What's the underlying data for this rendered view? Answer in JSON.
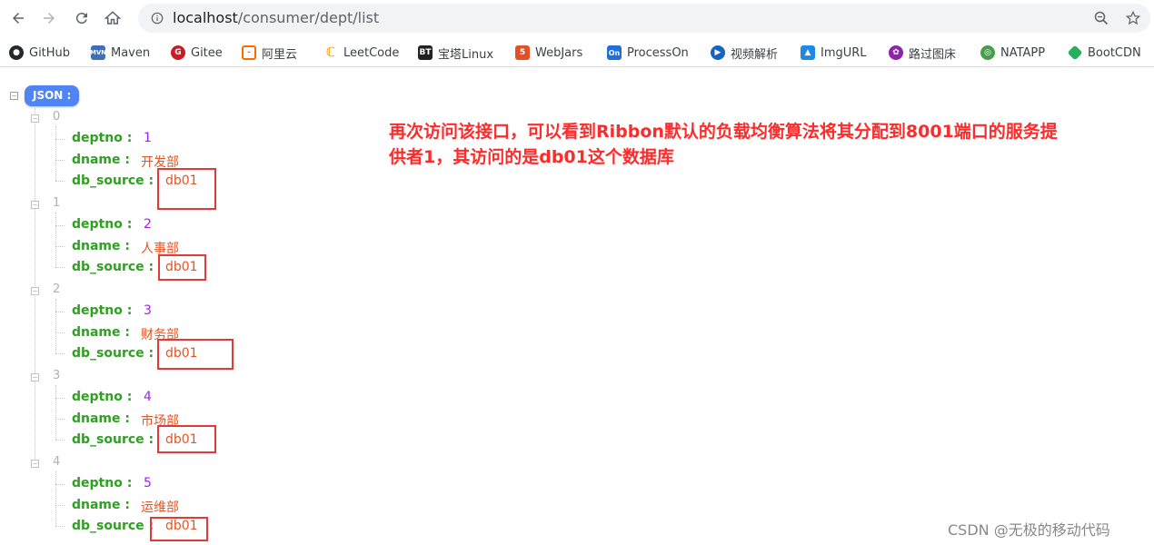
{
  "browser": {
    "url_host": "localhost",
    "url_path": "/consumer/dept/list"
  },
  "bookmarks": [
    {
      "label": "GitHub",
      "icon": "github-icon",
      "color": "#24292e"
    },
    {
      "label": "Maven",
      "icon": "maven-icon",
      "color": "#3f6fb5"
    },
    {
      "label": "Gitee",
      "icon": "gitee-icon",
      "color": "#c71d23"
    },
    {
      "label": "阿里云",
      "icon": "aliyun-icon",
      "color": "#ff6a00"
    },
    {
      "label": "LeetCode",
      "icon": "leetcode-icon",
      "color": "#ffa116"
    },
    {
      "label": "宝塔Linux",
      "icon": "bt-icon",
      "color": "#20a53a"
    },
    {
      "label": "WebJars",
      "icon": "webjars-icon",
      "color": "#e34f26"
    },
    {
      "label": "ProcessOn",
      "icon": "processon-icon",
      "color": "#1e6fd9"
    },
    {
      "label": "视频解析",
      "icon": "video-parse-icon",
      "color": "#1565c0"
    },
    {
      "label": "ImgURL",
      "icon": "imgurl-icon",
      "color": "#1e88e5"
    },
    {
      "label": "路过图床",
      "icon": "luguo-icon",
      "color": "#8e24aa"
    },
    {
      "label": "NATAPP",
      "icon": "natapp-icon",
      "color": "#43a047"
    },
    {
      "label": "BootCDN",
      "icon": "bootcdn-icon",
      "color": "#27ae60"
    }
  ],
  "json_view": {
    "root_label": "JSON :",
    "items": [
      {
        "index": "0",
        "deptno_key": "deptno :",
        "deptno": "1",
        "dname_key": "dname :",
        "dname": "开发部",
        "db_source_key": "db_source :",
        "db_source": "db01"
      },
      {
        "index": "1",
        "deptno_key": "deptno :",
        "deptno": "2",
        "dname_key": "dname :",
        "dname": "人事部",
        "db_source_key": "db_source :",
        "db_source": "db01"
      },
      {
        "index": "2",
        "deptno_key": "deptno :",
        "deptno": "3",
        "dname_key": "dname :",
        "dname": "财务部",
        "db_source_key": "db_source :",
        "db_source": "db01"
      },
      {
        "index": "3",
        "deptno_key": "deptno :",
        "deptno": "4",
        "dname_key": "dname :",
        "dname": "市场部",
        "db_source_key": "db_source :",
        "db_source": "db01"
      },
      {
        "index": "4",
        "deptno_key": "deptno :",
        "deptno": "5",
        "dname_key": "dname :",
        "dname": "运维部",
        "db_source_key": "db_source :",
        "db_source": "db01"
      }
    ]
  },
  "annotation": {
    "line1": "再次访问该接口，可以看到Ribbon默认的负载均衡算法将其分配到8001端口的服务提",
    "line2": "供者1，其访问的是db01这个数据库"
  },
  "watermark": "CSDN @无极的移动代码",
  "colors": {
    "key": "#2ea121",
    "number": "#a020f0",
    "string": "#e8531f",
    "annotation": "#ff2a2a",
    "highlight_box": "#e53935",
    "root_badge": "#4f84f5"
  }
}
